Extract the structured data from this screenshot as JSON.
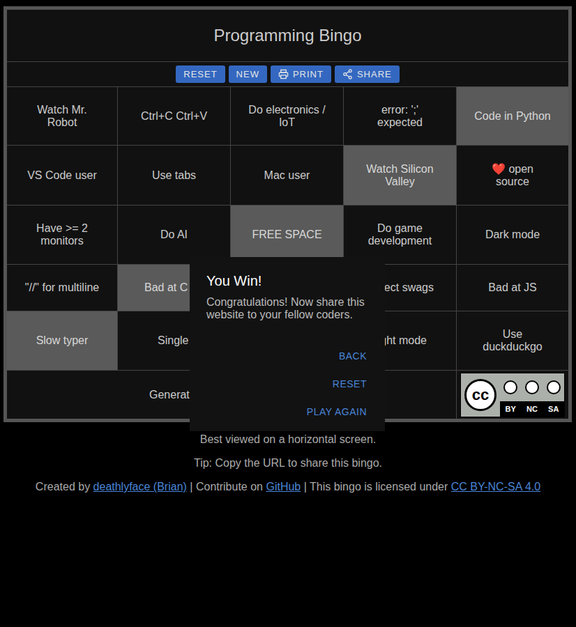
{
  "title": "Programming Bingo",
  "toolbar": [
    {
      "label": "RESET",
      "icon": false
    },
    {
      "label": "NEW",
      "icon": false
    },
    {
      "label": "PRINT",
      "icon": "print"
    },
    {
      "label": "SHARE",
      "icon": "share"
    }
  ],
  "rows": [
    [
      {
        "text": "Watch Mr.\nRobot",
        "marked": false
      },
      {
        "text": "Ctrl+C Ctrl+V",
        "marked": false
      },
      {
        "text": "Do electronics /\nIoT",
        "marked": false
      },
      {
        "text": "error: ';'\nexpected",
        "marked": false
      },
      {
        "text": "Code in Python",
        "marked": true
      }
    ],
    [
      {
        "text": "VS Code user",
        "marked": false
      },
      {
        "text": "Use tabs",
        "marked": false
      },
      {
        "text": "Mac user",
        "marked": false
      },
      {
        "text": "Watch Silicon\nValley",
        "marked": true
      },
      {
        "text": "❤️ open\nsource",
        "marked": false
      }
    ],
    [
      {
        "text": "Have >= 2\nmonitors",
        "marked": false
      },
      {
        "text": "Do AI",
        "marked": false
      },
      {
        "text": "FREE SPACE",
        "marked": true
      },
      {
        "text": "Do game\ndevelopment",
        "marked": false
      },
      {
        "text": "Dark mode",
        "marked": false
      }
    ],
    [
      {
        "text": "\"//\" for multiline",
        "marked": false
      },
      {
        "text": "Bad at C",
        "marked": true
      },
      {
        "text": "",
        "marked": false
      },
      {
        "text": "ect swags",
        "marked": false
      },
      {
        "text": "Bad at JS",
        "marked": false
      }
    ],
    [
      {
        "text": "Slow typer",
        "marked": true
      },
      {
        "text": "Single",
        "marked": false
      },
      {
        "text": "",
        "marked": false
      },
      {
        "text": "ght mode",
        "marked": false
      },
      {
        "text": "Use\nduckduckgo",
        "marked": false
      }
    ]
  ],
  "last_cell": {
    "text": "Generat",
    "marked": false
  },
  "cc_badge": {
    "logo": "cc",
    "labels": [
      "BY",
      "NC",
      "SA"
    ]
  },
  "dialog": {
    "title": "You Win!",
    "message": "Congratulations! Now share this website to your fellow coders.",
    "buttons": [
      "BACK",
      "RESET",
      "PLAY AGAIN"
    ]
  },
  "footer": {
    "hint": "Best viewed on a horizontal screen.",
    "tip": "Tip: Copy the URL to share this bingo.",
    "credits": [
      {
        "text": "Created by ",
        "link": false
      },
      {
        "text": "deathlyface (Brian)",
        "link": true
      },
      {
        "text": " | Contribute on ",
        "link": false
      },
      {
        "text": "GitHub",
        "link": true
      },
      {
        "text": " | This bingo is licensed under ",
        "link": false
      },
      {
        "text": "CC BY-NC-SA 4.0",
        "link": true
      }
    ]
  }
}
